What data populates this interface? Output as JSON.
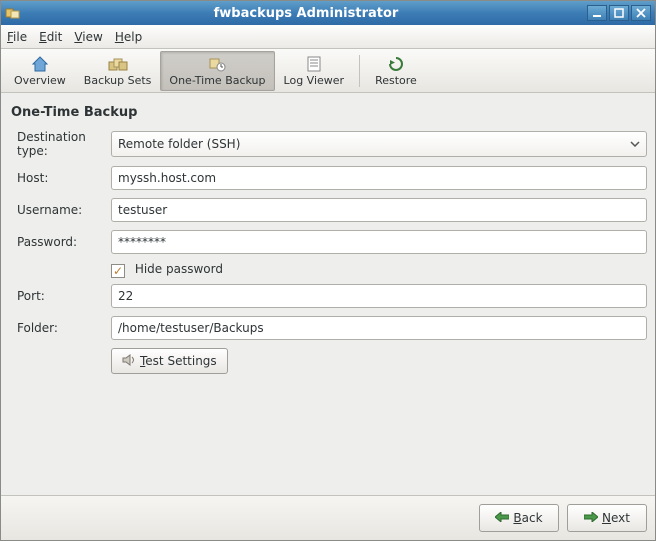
{
  "titlebar": {
    "title": "fwbackups Administrator"
  },
  "menubar": [
    "File",
    "Edit",
    "View",
    "Help"
  ],
  "toolbar": {
    "items": [
      {
        "label": "Overview",
        "icon": "home"
      },
      {
        "label": "Backup Sets",
        "icon": "sets"
      },
      {
        "label": "One-Time Backup",
        "icon": "otb",
        "active": true
      },
      {
        "label": "Log Viewer",
        "icon": "log"
      }
    ],
    "restore": {
      "label": "Restore",
      "icon": "restore"
    }
  },
  "page": {
    "heading": "One-Time Backup",
    "destType": {
      "label": "Destination type:",
      "value": "Remote folder (SSH)"
    },
    "host": {
      "label": "Host:",
      "value": "myssh.host.com"
    },
    "username": {
      "label": "Username:",
      "value": "testuser"
    },
    "password": {
      "label": "Password:",
      "value": "********"
    },
    "hidepw": {
      "label": "Hide password",
      "checked": true
    },
    "port": {
      "label": "Port:",
      "value": "22"
    },
    "folder": {
      "label": "Folder:",
      "value": "/home/testuser/Backups"
    },
    "testbtn": "Test Settings"
  },
  "nav": {
    "back": "Back",
    "next": "Next"
  }
}
